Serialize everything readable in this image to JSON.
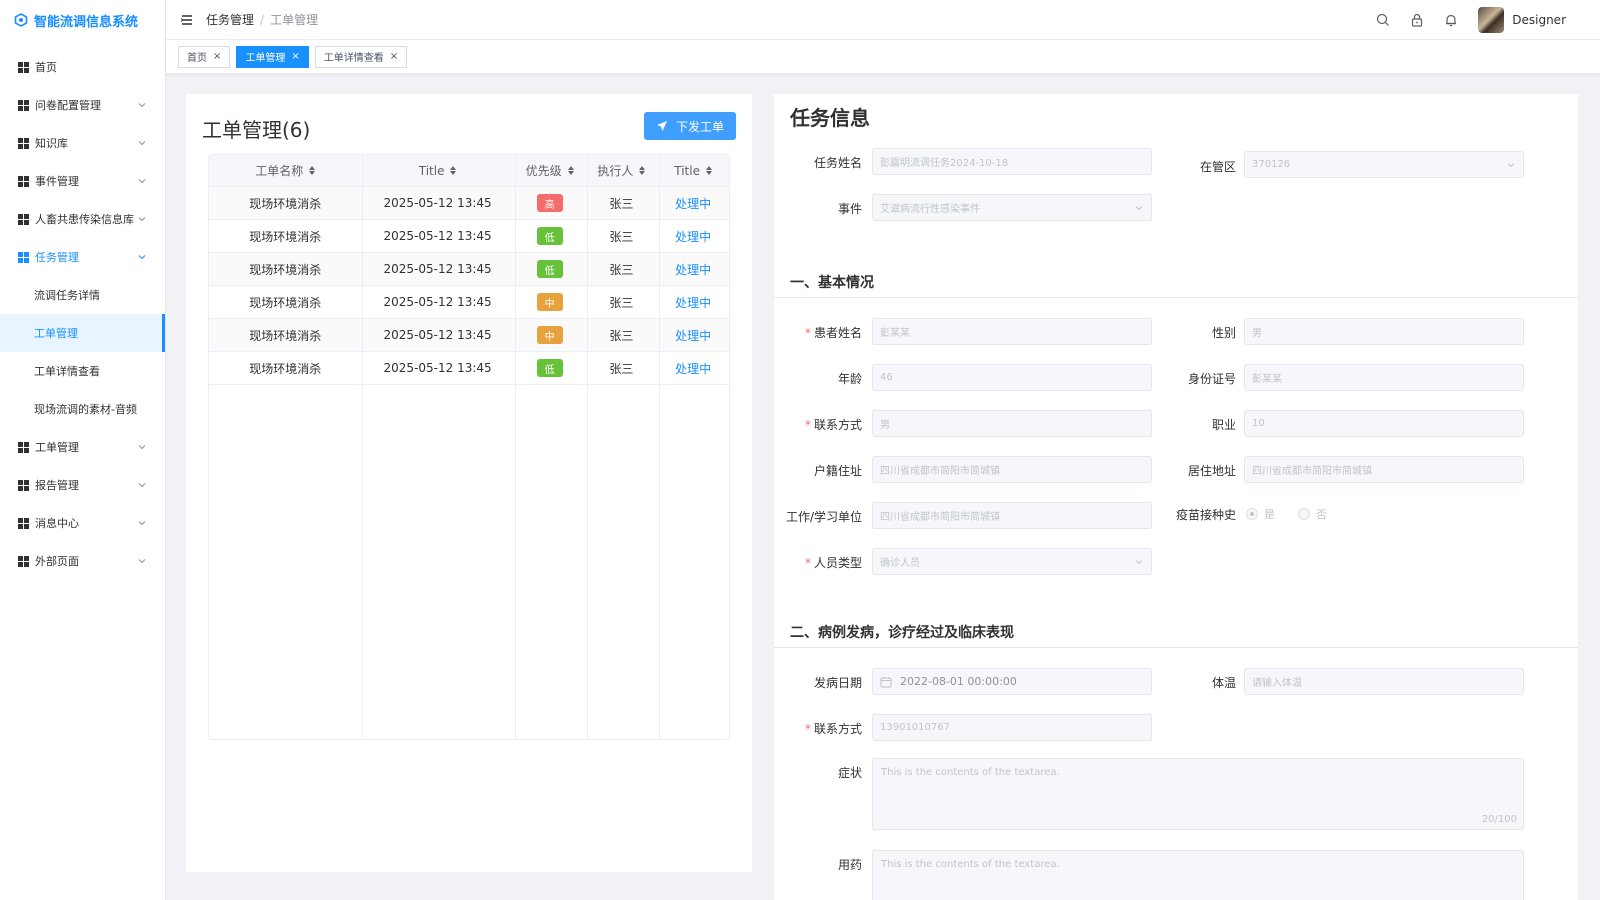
{
  "app": {
    "title": "智能流调信息系统"
  },
  "sidebar": {
    "items": [
      {
        "label": "首页",
        "has_children": false
      },
      {
        "label": "问卷配置管理",
        "has_children": true
      },
      {
        "label": "知识库",
        "has_children": true
      },
      {
        "label": "事件管理",
        "has_children": true
      },
      {
        "label": "人畜共患传染信息库",
        "has_children": true
      },
      {
        "label": "任务管理",
        "has_children": true,
        "expanded": true
      },
      {
        "label": "工单管理",
        "has_children": true
      },
      {
        "label": "报告管理",
        "has_children": true
      },
      {
        "label": "消息中心",
        "has_children": true
      },
      {
        "label": "外部页面",
        "has_children": true
      }
    ],
    "task_sub_items": [
      {
        "label": "流调任务详情"
      },
      {
        "label": "工单管理",
        "selected": true
      },
      {
        "label": "工单详情查看"
      },
      {
        "label": "现场流调的素材-音频"
      }
    ]
  },
  "header": {
    "breadcrumb": [
      "任务管理",
      "工单管理"
    ],
    "user_name": "Designer"
  },
  "tags": [
    {
      "label": "首页",
      "active": false
    },
    {
      "label": "工单管理",
      "active": true
    },
    {
      "label": "工单详情查看",
      "active": false
    }
  ],
  "work_orders": {
    "title": "工单管理(6)",
    "issue_button": "下发工单",
    "columns": [
      "工单名称",
      "Title",
      "优先级",
      "执行人",
      "Title"
    ],
    "rows": [
      {
        "name": "现场环境消杀",
        "time": "2025-05-12 13:45",
        "priority": "高",
        "priority_color": "#f56c6c",
        "assignee": "张三",
        "status": "处理中"
      },
      {
        "name": "现场环境消杀",
        "time": "2025-05-12 13:45",
        "priority": "低",
        "priority_color": "#67c23a",
        "assignee": "张三",
        "status": "处理中"
      },
      {
        "name": "现场环境消杀",
        "time": "2025-05-12 13:45",
        "priority": "低",
        "priority_color": "#67c23a",
        "assignee": "张三",
        "status": "处理中"
      },
      {
        "name": "现场环境消杀",
        "time": "2025-05-12 13:45",
        "priority": "中",
        "priority_color": "#e6a23c",
        "assignee": "张三",
        "status": "处理中"
      },
      {
        "name": "现场环境消杀",
        "time": "2025-05-12 13:45",
        "priority": "中",
        "priority_color": "#e6a23c",
        "assignee": "张三",
        "status": "处理中"
      },
      {
        "name": "现场环境消杀",
        "time": "2025-05-12 13:45",
        "priority": "低",
        "priority_color": "#67c23a",
        "assignee": "张三",
        "status": "处理中"
      }
    ]
  },
  "task_info": {
    "title": "任务信息",
    "task_name_label": "任务姓名",
    "task_name_value": "彭震明流调任务2024-10-18",
    "district_label": "在管区",
    "district_value": "370126",
    "event_label": "事件",
    "event_value": "艾滋病流行性感染事件",
    "section1": "一、基本情况",
    "patient_name_label": "患者姓名",
    "patient_name_value": "彭某某",
    "gender_label": "性别",
    "gender_value": "男",
    "age_label": "年龄",
    "age_value": "46",
    "id_label": "身份证号",
    "id_value": "彭某某",
    "contact_label": "联系方式",
    "contact_value": "男",
    "job_label": "职业",
    "job_value": "10",
    "household_label": "户籍住址",
    "household_value": "四川省成都市简阳市简城镇",
    "residence_label": "居住地址",
    "residence_value": "四川省成都市简阳市简城镇",
    "work_label": "工作/学习单位",
    "work_value": "四川省成都市简阳市简城镇",
    "vaccine_label": "疫苗接种史",
    "vaccine_yes": "是",
    "vaccine_no": "否",
    "person_type_label": "人员类型",
    "person_type_value": "确诊人员",
    "section2": "二、病例发病，诊疗经过及临床表现",
    "onset_label": "发病日期",
    "onset_value": "2022-08-01 00:00:00",
    "temp_label": "体温",
    "temp_placeholder": "请输入体温",
    "contact2_label": "联系方式",
    "contact2_value": "13901010767",
    "symptom_label": "症状",
    "symptom_value": "This is the contents of the textarea.",
    "symptom_count": "20/100",
    "medicine_label": "用药",
    "medicine_value": "This is the contents of the textarea."
  }
}
